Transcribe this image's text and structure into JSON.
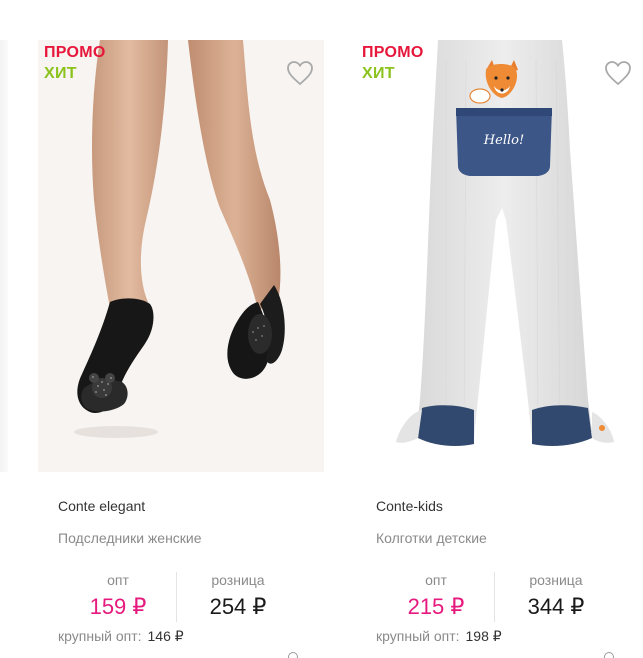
{
  "products": [
    {
      "badges": {
        "promo": "ПРОМО",
        "hit": "ХИТ"
      },
      "brand": "Conte elegant",
      "name": "Подследники женские",
      "price_opt_label": "опт",
      "price_opt": "159 ₽",
      "price_retail_label": "розница",
      "price_retail": "254 ₽",
      "bulk_label": "крупный опт:",
      "bulk_value": "146 ₽",
      "image": "black-footie-socks-image"
    },
    {
      "badges": {
        "promo": "ПРОМО",
        "hit": "ХИТ"
      },
      "brand": "Conte-kids",
      "name": "Колготки детские",
      "price_opt_label": "опт",
      "price_opt": "215 ₽",
      "price_retail_label": "розница",
      "price_retail": "344 ₽",
      "bulk_label": "крупный опт:",
      "bulk_value": "198 ₽",
      "image": "kids-tights-fox-image",
      "image_text": "Hello!"
    }
  ],
  "colors": {
    "promo": "#e6173b",
    "hit": "#8bc31c",
    "opt_price": "#e6197e",
    "retail_price": "#1a1a1a",
    "muted": "#8a8a8a"
  }
}
